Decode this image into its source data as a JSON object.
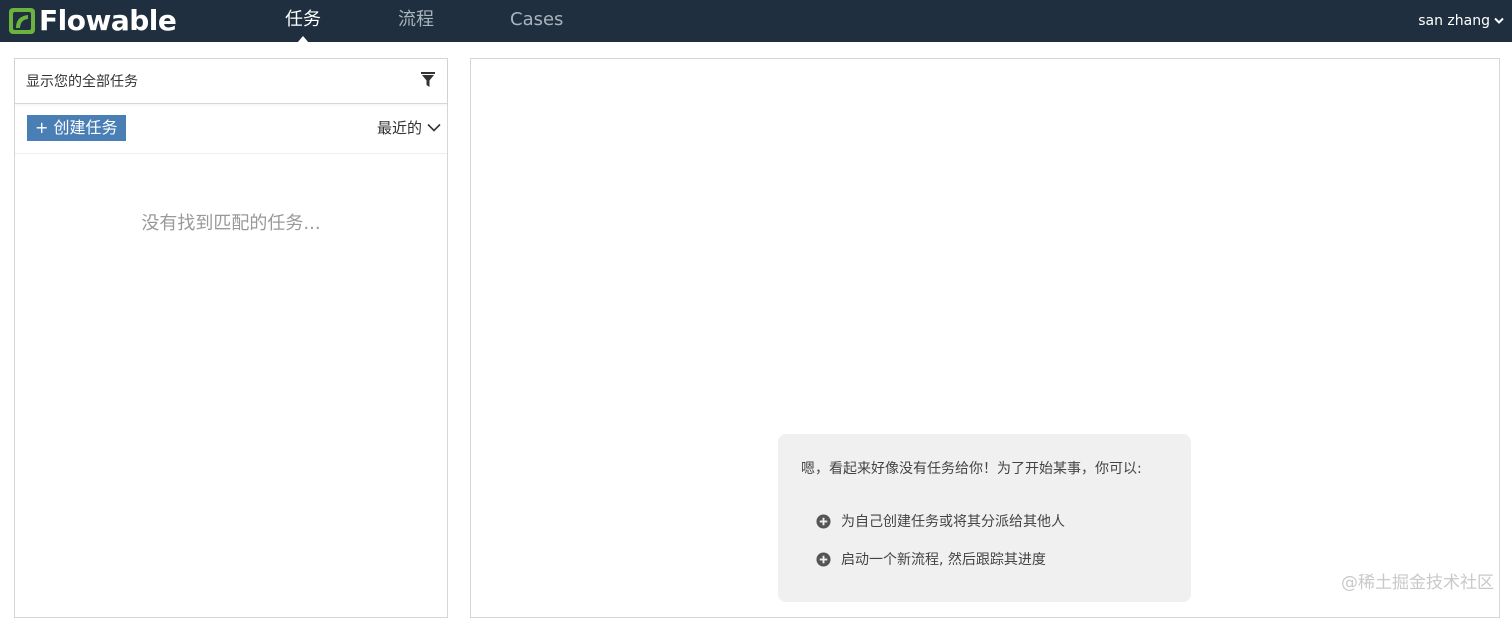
{
  "header": {
    "logo_text": "Flowable",
    "tabs": [
      {
        "label": "任务",
        "active": true
      },
      {
        "label": "流程",
        "active": false
      },
      {
        "label": "Cases",
        "active": false
      }
    ],
    "user": "san zhang"
  },
  "task_list": {
    "filter_label": "显示您的全部任务",
    "create_button": "+ 创建任务",
    "sort_label": "最近的",
    "empty_message": "没有找到匹配的任务..."
  },
  "help": {
    "intro": "嗯，看起来好像没有任务给你！为了开始某事，你可以:",
    "items": [
      "为自己创建任务或将其分派给其他人",
      "启动一个新流程, 然后跟踪其进度"
    ]
  },
  "watermark": "@稀土掘金技术社区",
  "colors": {
    "topbar": "#1f2f3f",
    "logo_green": "#6cb33e",
    "primary_button": "#4a7fb5",
    "help_box": "#f0f0f0"
  },
  "icons": [
    "flowable-logo-icon",
    "chevron-down-icon",
    "filter-icon",
    "plus-circle-icon"
  ]
}
